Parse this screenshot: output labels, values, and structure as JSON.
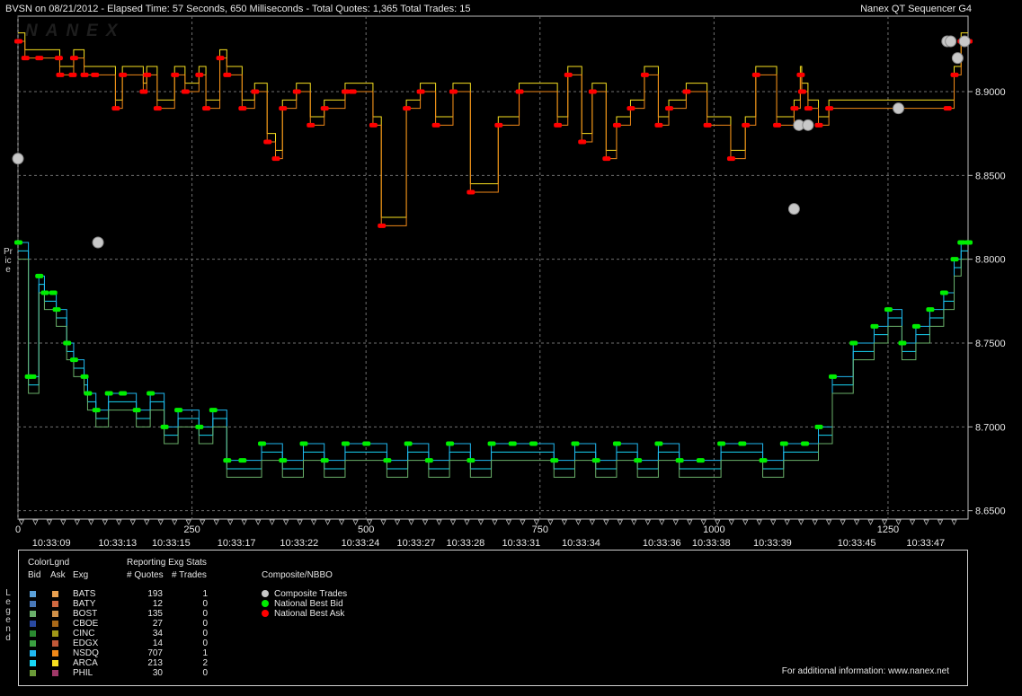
{
  "header": {
    "left": "BVSN on 08/21/2012  -  Elapsed Time: 57 Seconds, 650 Milliseconds  -  Total Quotes: 1,365  Total Trades: 15",
    "right": "Nanex QT Sequencer G4"
  },
  "watermark": "NANEX",
  "y_axis_label": "Price",
  "legend_side_label": "Legend",
  "chart_data": {
    "type": "line",
    "title": "",
    "xlabel": "",
    "ylabel": "Price",
    "xlim": [
      0,
      1365
    ],
    "ylim": [
      8.645,
      8.945
    ],
    "grid": true,
    "y_ticks": [
      {
        "v": 8.65,
        "label": "8.6500"
      },
      {
        "v": 8.7,
        "label": "8.7000"
      },
      {
        "v": 8.75,
        "label": "8.7500"
      },
      {
        "v": 8.8,
        "label": "8.8000"
      },
      {
        "v": 8.85,
        "label": "8.8500"
      },
      {
        "v": 8.9,
        "label": "8.9000"
      }
    ],
    "x_count_ticks": [
      {
        "v": 0,
        "label": "0"
      },
      {
        "v": 250,
        "label": "250"
      },
      {
        "v": 500,
        "label": "500"
      },
      {
        "v": 750,
        "label": "750"
      },
      {
        "v": 1000,
        "label": "1000"
      },
      {
        "v": 1250,
        "label": "1250"
      }
    ],
    "x_time_ticks": [
      {
        "v": 48,
        "label": "10:33:09"
      },
      {
        "v": 143,
        "label": "10:33:13"
      },
      {
        "v": 220,
        "label": "10:33:15"
      },
      {
        "v": 314,
        "label": "10:33:17"
      },
      {
        "v": 404,
        "label": "10:33:22"
      },
      {
        "v": 492,
        "label": "10:33:24"
      },
      {
        "v": 572,
        "label": "10:33:27"
      },
      {
        "v": 643,
        "label": "10:33:28"
      },
      {
        "v": 723,
        "label": "10:33:31"
      },
      {
        "v": 809,
        "label": "10:33:34"
      },
      {
        "v": 925,
        "label": "10:33:36"
      },
      {
        "v": 996,
        "label": "10:33:38"
      },
      {
        "v": 1084,
        "label": "10:33:39"
      },
      {
        "v": 1205,
        "label": "10:33:45"
      },
      {
        "v": 1304,
        "label": "10:33:47"
      }
    ],
    "series": [
      {
        "name": "National Best Ask",
        "color": "#ff0000",
        "x": [
          0,
          10,
          30,
          58,
          60,
          78,
          80,
          95,
          110,
          140,
          150,
          180,
          185,
          200,
          225,
          240,
          260,
          270,
          290,
          300,
          322,
          340,
          358,
          370,
          380,
          400,
          420,
          440,
          470,
          480,
          510,
          522,
          558,
          578,
          600,
          625,
          650,
          690,
          720,
          775,
          790,
          810,
          825,
          845,
          860,
          880,
          900,
          920,
          935,
          960,
          990,
          1024,
          1045,
          1060,
          1090,
          1115,
          1124,
          1126,
          1135,
          1150,
          1165,
          1335,
          1345,
          1355,
          1365
        ],
        "y": [
          8.93,
          8.92,
          8.92,
          8.92,
          8.91,
          8.91,
          8.92,
          8.91,
          8.91,
          8.89,
          8.91,
          8.9,
          8.91,
          8.89,
          8.91,
          8.9,
          8.91,
          8.89,
          8.92,
          8.91,
          8.89,
          8.9,
          8.87,
          8.86,
          8.89,
          8.9,
          8.88,
          8.89,
          8.9,
          8.9,
          8.88,
          8.82,
          8.89,
          8.9,
          8.88,
          8.9,
          8.84,
          8.88,
          8.9,
          8.88,
          8.91,
          8.87,
          8.9,
          8.86,
          8.88,
          8.89,
          8.91,
          8.88,
          8.89,
          8.9,
          8.88,
          8.86,
          8.88,
          8.91,
          8.88,
          8.89,
          8.91,
          8.9,
          8.89,
          8.88,
          8.89,
          8.89,
          8.91,
          8.93,
          8.93
        ]
      },
      {
        "name": "National Best Bid",
        "color": "#00ee00",
        "x": [
          0,
          15,
          20,
          30,
          38,
          50,
          55,
          70,
          80,
          95,
          100,
          112,
          130,
          150,
          170,
          190,
          210,
          230,
          260,
          280,
          300,
          322,
          350,
          380,
          410,
          440,
          470,
          500,
          530,
          560,
          590,
          620,
          650,
          680,
          710,
          740,
          770,
          800,
          830,
          860,
          890,
          920,
          950,
          980,
          1010,
          1040,
          1070,
          1100,
          1130,
          1150,
          1170,
          1200,
          1230,
          1250,
          1270,
          1290,
          1310,
          1330,
          1345,
          1355,
          1365
        ],
        "y": [
          8.81,
          8.73,
          8.73,
          8.79,
          8.78,
          8.78,
          8.77,
          8.75,
          8.74,
          8.73,
          8.72,
          8.71,
          8.72,
          8.72,
          8.71,
          8.72,
          8.7,
          8.71,
          8.7,
          8.71,
          8.68,
          8.68,
          8.69,
          8.68,
          8.69,
          8.68,
          8.69,
          8.69,
          8.68,
          8.69,
          8.68,
          8.69,
          8.68,
          8.69,
          8.69,
          8.69,
          8.68,
          8.69,
          8.68,
          8.69,
          8.68,
          8.69,
          8.68,
          8.68,
          8.69,
          8.69,
          8.68,
          8.69,
          8.69,
          8.7,
          8.73,
          8.75,
          8.76,
          8.77,
          8.75,
          8.76,
          8.77,
          8.78,
          8.8,
          8.81,
          8.81
        ]
      },
      {
        "name": "Composite Trades",
        "color": "#c8c8c8",
        "x": [
          0,
          115,
          1115,
          1122,
          1135,
          1265,
          1335,
          1340,
          1350,
          1360
        ],
        "y": [
          8.86,
          8.81,
          8.83,
          8.88,
          8.88,
          8.89,
          8.93,
          8.93,
          8.92,
          8.93
        ]
      }
    ]
  },
  "legend": {
    "col_headers": {
      "colorlgnd": "ColorLgnd",
      "bid": "Bid",
      "ask": "Ask",
      "exg": "Exg",
      "reporting": "Reporting Exg Stats",
      "quotes": "# Quotes",
      "trades": "# Trades",
      "composite": "Composite/NBBO"
    },
    "exchanges": [
      {
        "name": "BATS",
        "quotes": "193",
        "trades": "1",
        "bid": "#5aa0d8",
        "ask": "#e8a050"
      },
      {
        "name": "BATY",
        "quotes": "12",
        "trades": "0",
        "bid": "#4878b8",
        "ask": "#d06840"
      },
      {
        "name": "BOST",
        "quotes": "135",
        "trades": "0",
        "bid": "#6ab06a",
        "ask": "#d09048"
      },
      {
        "name": "CBOE",
        "quotes": "27",
        "trades": "0",
        "bid": "#2848a0",
        "ask": "#a86818"
      },
      {
        "name": "CINC",
        "quotes": "34",
        "trades": "0",
        "bid": "#2a8a30",
        "ask": "#a09818"
      },
      {
        "name": "EDGX",
        "quotes": "14",
        "trades": "0",
        "bid": "#3aa040",
        "ask": "#c05838"
      },
      {
        "name": "NSDQ",
        "quotes": "707",
        "trades": "1",
        "bid": "#20b8f0",
        "ask": "#f08818"
      },
      {
        "name": "ARCA",
        "quotes": "213",
        "trades": "2",
        "bid": "#18d8f8",
        "ask": "#f8e020"
      },
      {
        "name": "PHIL",
        "quotes": "30",
        "trades": "0",
        "bid": "#6a9a38",
        "ask": "#a03868"
      }
    ],
    "composite": [
      {
        "label": "Composite Trades",
        "color": "#c8c8c8"
      },
      {
        "label": "National Best Bid",
        "color": "#00ee00"
      },
      {
        "label": "National Best Ask",
        "color": "#ff0000"
      }
    ],
    "footer": "For additional information: www.nanex.net"
  }
}
